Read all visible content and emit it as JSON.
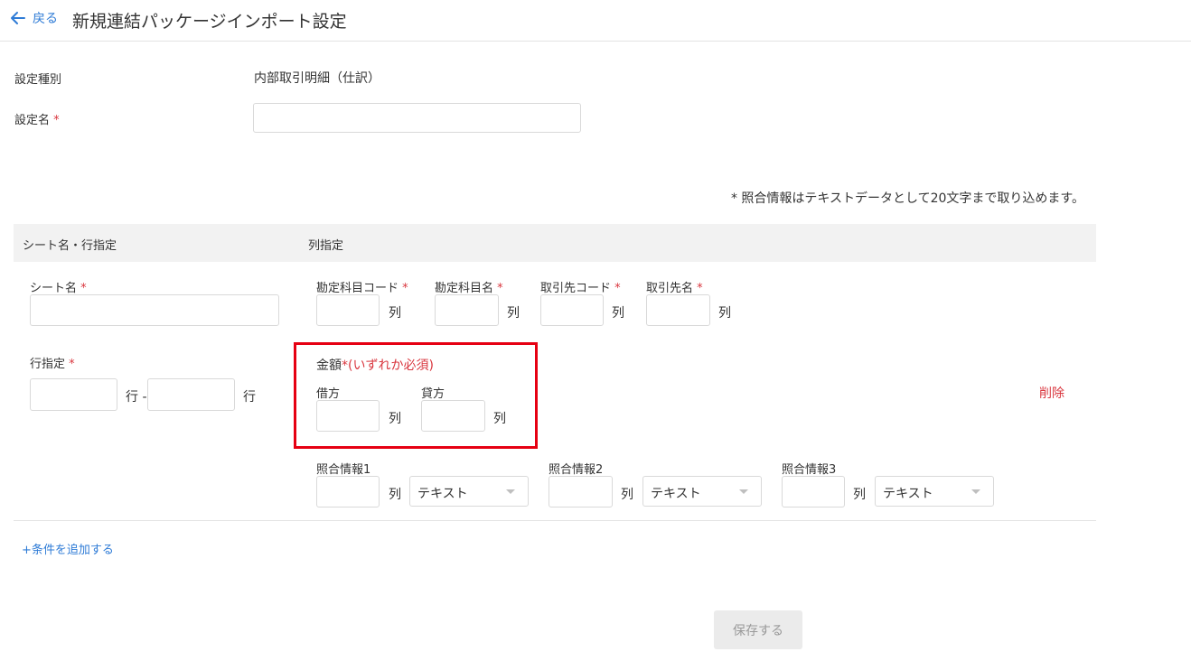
{
  "header": {
    "back_label": "戻る",
    "title": "新規連結パッケージインポート設定"
  },
  "form": {
    "setting_type_label": "設定種別",
    "setting_type_value": "内部取引明細（仕訳）",
    "setting_name_label": "設定名",
    "setting_name_value": "",
    "required_mark": "*"
  },
  "note": "* 照合情報はテキストデータとして20文字まで取り込めます。",
  "table": {
    "col_sheet_row": "シート名・行指定",
    "col_column": "列指定"
  },
  "sheet": {
    "sheet_name_label": "シート名",
    "sheet_name_value": "",
    "row_label": "行指定",
    "row_from_value": "",
    "row_to_value": "",
    "row_unit_from": "行 -",
    "row_unit_to": "行"
  },
  "columns": {
    "unit": "列",
    "account_code_label": "勘定科目コード",
    "account_name_label": "勘定科目名",
    "partner_code_label": "取引先コード",
    "partner_name_label": "取引先名"
  },
  "amount": {
    "label": "金額",
    "required_note": "*(いずれか必須)",
    "debit_label": "借方",
    "credit_label": "貸方"
  },
  "match": {
    "info1_label": "照合情報1",
    "info2_label": "照合情報2",
    "info3_label": "照合情報3",
    "type_selected": "テキスト"
  },
  "actions": {
    "delete_label": "削除",
    "add_condition_label": "+条件を追加する",
    "save_label": "保存する"
  },
  "colors": {
    "link": "#2e7bd6",
    "required": "#d9363e",
    "highlight_border": "#e60012"
  }
}
